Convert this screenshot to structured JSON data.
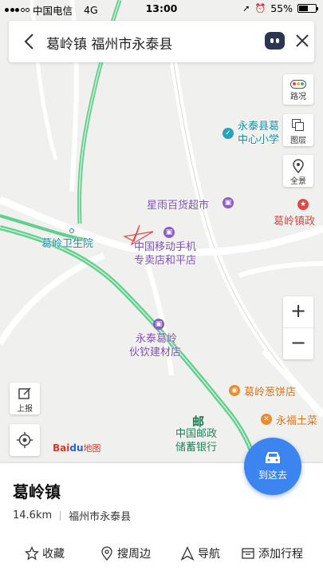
{
  "status_bar": {
    "carrier": "中国电信",
    "network": "4G",
    "time": "13:00",
    "battery": "55%",
    "battery_level": 0.55
  },
  "search": {
    "query": "葛岭镇 福州市永泰县"
  },
  "map_tools": {
    "traffic": "路况",
    "layers": "图层",
    "panorama": "全景",
    "zoom_in": "+",
    "zoom_out": "−",
    "report": "上报"
  },
  "map_labels": {
    "poi_school_line1": "永泰县葛",
    "poi_school_line2": "中心小学",
    "poi_supermarket": "星雨百货超市",
    "poi_government": "葛岭镇政",
    "poi_hospital": "葛岭卫生院",
    "poi_mobile_line1": "中国移动手机",
    "poi_mobile_line2": "专卖店和平店",
    "poi_building_line1": "永泰葛岭",
    "poi_building_line2": "伙钦建材店",
    "poi_bakery": "葛岭葱饼店",
    "poi_restaurant": "永福土菜",
    "poi_post_line1": "中国邮政",
    "poi_post_line2": "储蓄银行"
  },
  "brand": {
    "bai": "Bai",
    "du": "du",
    "map": "地图"
  },
  "goto_button": "到这去",
  "place": {
    "name": "葛岭镇",
    "distance": "14.6km",
    "region": "福州市永泰县"
  },
  "actions": {
    "favorite": "收藏",
    "nearby": "搜周边",
    "navigate": "导航",
    "add_trip": "添加行程"
  },
  "colors": {
    "accent": "#3c85f0",
    "highway": "#5fcf8a",
    "red_marker": "#e24646"
  }
}
